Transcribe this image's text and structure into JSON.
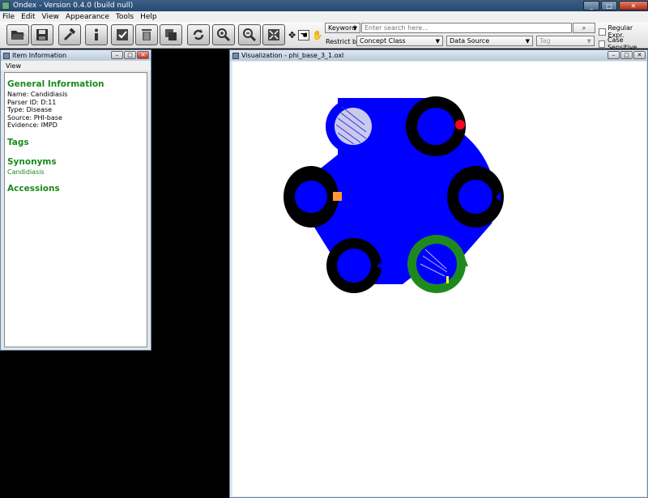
{
  "window": {
    "title": "Ondex - Version 0.4.0 (build null)"
  },
  "menubar": [
    "File",
    "Edit",
    "View",
    "Appearance",
    "Tools",
    "Help"
  ],
  "toolbar": {
    "buttons": [
      "open",
      "save",
      "tools",
      "info",
      "check",
      "delete",
      "copy",
      "refresh",
      "zoom-in",
      "zoom-out",
      "fit"
    ]
  },
  "search": {
    "mode": "Keyword",
    "placeholder": "Enter search here...",
    "restrict_label": "Restrict by:",
    "concept_class": "Concept Class",
    "data_source": "Data Source",
    "tag": "Tag",
    "regular_expr": "Regular Expr.",
    "case_sensitive": "Case Sensitive"
  },
  "item_info": {
    "title": "Item Information",
    "menu": "View",
    "general_heading": "General Information",
    "name": "Name: Candidiasis",
    "parser_id": "Parser ID: D:11",
    "type": "Type: Disease",
    "source": "Source: PHI-base",
    "evidence": "Evidence: IMPD",
    "tags_heading": "Tags",
    "synonyms_heading": "Synonyms",
    "synonym": "Candidiasis",
    "accessions_heading": "Accessions"
  },
  "visualization": {
    "title": "Visualization - phi_base_3_1.oxl"
  },
  "colors": {
    "edge_blue": "#0000ff",
    "cluster_black": "#000000",
    "cluster_green": "#1e8a1e",
    "heading_green": "#1b8a1b",
    "node_red": "#ff0022",
    "node_orange": "#ff9933"
  }
}
